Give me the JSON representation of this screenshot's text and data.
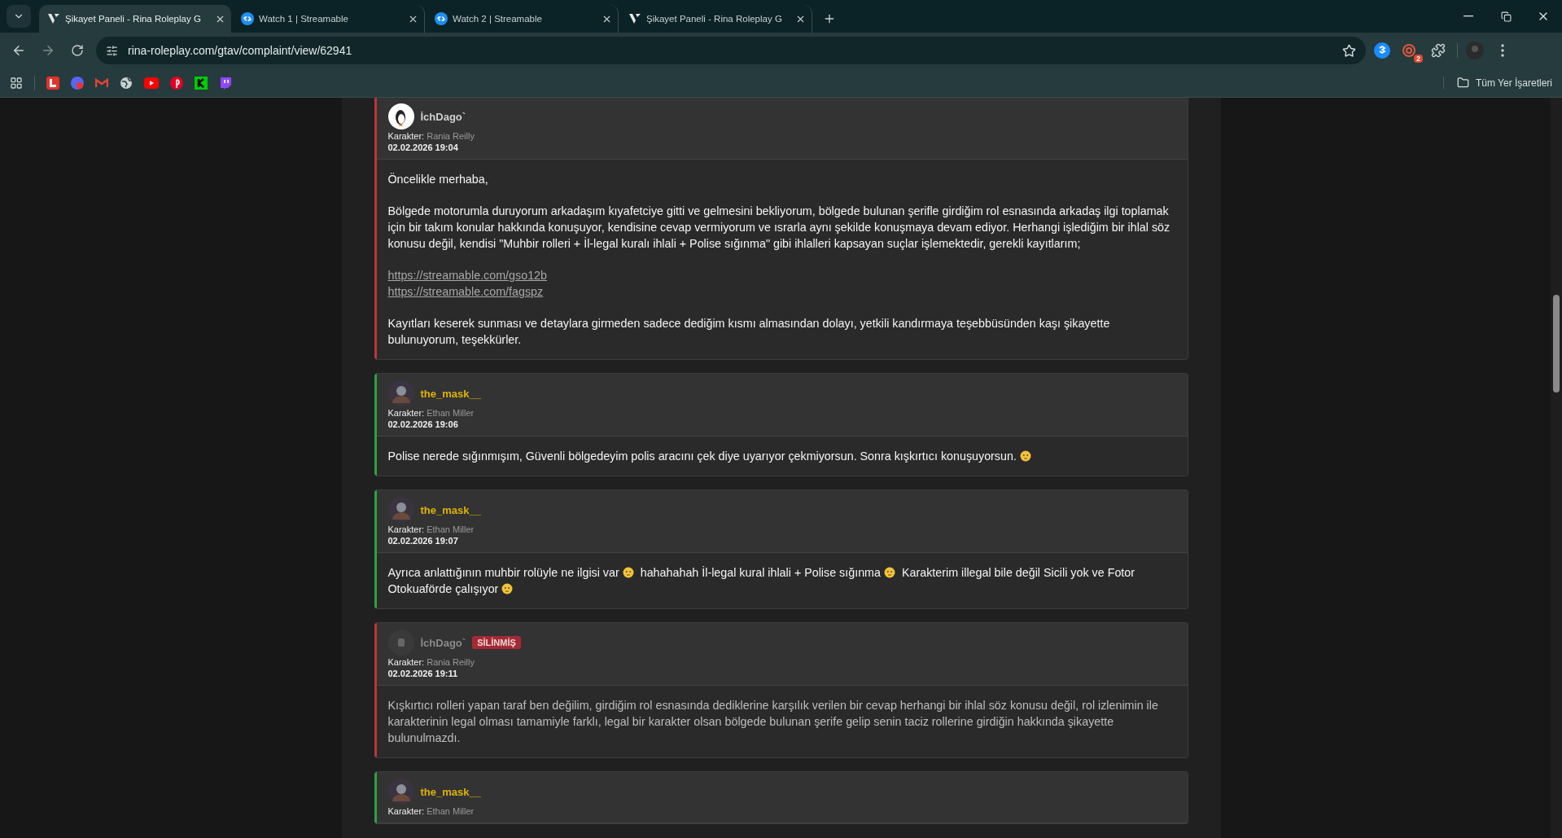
{
  "browser": {
    "tabs": [
      {
        "title": "Şikayet Paneli - Rina Roleplay G",
        "selected": true,
        "kind": "panel"
      },
      {
        "title": "Watch 1 | Streamable",
        "selected": false,
        "kind": "streamable"
      },
      {
        "title": "Watch 2 | Streamable",
        "selected": false,
        "kind": "streamable"
      },
      {
        "title": "Şikayet Paneli - Rina Roleplay G",
        "selected": false,
        "kind": "panel"
      }
    ],
    "address": "rina-roleplay.com/gtav/complaint/view/62941",
    "extension_badge": "2",
    "bookmarks_label": "Tüm Yer İşaretleri"
  },
  "posts": [
    {
      "author": "İchDago`",
      "kind": "complainant",
      "color": "#c0323c",
      "deleted": false,
      "character_label": "Karakter:",
      "character": "Rania Reilly",
      "date": "02.02.2026 19:04",
      "paragraphs": [
        [
          {
            "kind": "text",
            "text": "Öncelikle merhaba,"
          }
        ],
        [
          {
            "kind": "text",
            "text": "Bölgede motorumla duruyorum arkadaşım kıyafetciye gitti ve gelmesini bekliyorum, bölgede bulunan şerifle girdiğim rol esnasında arkadaş ilgi toplamak için bir takım konular hakkında konuşuyor, kendisine cevap vermiyorum ve ısrarla aynı şekilde konuşmaya devam ediyor. Herhangi işlediğim bir ihlal söz konusu değil, kendisi \"Muhbir rolleri + İl-legal kuralı ihlali + Polise sığınma\" gibi ihlalleri kapsayan suçlar işlemektedir, gerekli kayıtlarım;"
          }
        ],
        [
          {
            "kind": "link",
            "text": "https://streamable.com/gso12b"
          },
          {
            "kind": "link",
            "text": "https://streamable.com/fagspz"
          }
        ],
        [
          {
            "kind": "text",
            "text": "Kayıtları keserek sunması ve detaylara girmeden sadece dediğim kısmı almasından dolayı, yetkili kandırmaya teşebbüsünden kaşı şikayette bulunuyorum, teşekkürler."
          }
        ]
      ]
    },
    {
      "author": "the_mask__",
      "kind": "respondent",
      "color": "#2ea043",
      "deleted": false,
      "character_label": "Karakter:",
      "character": "Ethan Miller",
      "date": "02.02.2026 19:06",
      "paragraphs": [
        [
          {
            "kind": "text",
            "text": "Polise nerede sığınmışım, Güvenli bölgedeyim polis aracını çek diye uyarıyor çekmiyorsun. Sonra kışkırtıcı konuşuyorsun."
          },
          {
            "kind": "emoji"
          }
        ]
      ]
    },
    {
      "author": "the_mask__",
      "kind": "respondent",
      "color": "#2ea043",
      "deleted": false,
      "character_label": "Karakter:",
      "character": "Ethan Miller",
      "date": "02.02.2026 19:07",
      "paragraphs": [
        [
          {
            "kind": "text",
            "text": "Ayrıca anlattığının muhbir rolüyle ne ilgisi var"
          },
          {
            "kind": "emoji"
          },
          {
            "kind": "text",
            "text": "hahahahah İl-legal kural ihlali + Polise sığınma"
          },
          {
            "kind": "emoji"
          },
          {
            "kind": "text",
            "text": "Karakterim illegal bile değil Sicili yok ve Fotor Otokuaförde çalışıyor"
          },
          {
            "kind": "emoji"
          }
        ]
      ]
    },
    {
      "author": "İchDago`",
      "kind": "complainant",
      "color": "#c0323c",
      "deleted": true,
      "badge": "SİLİNMİŞ",
      "character_label": "Karakter:",
      "character": "Rania Reilly",
      "date": "02.02.2026 19:11",
      "paragraphs": [
        [
          {
            "kind": "text",
            "text": "Kışkırtıcı rolleri yapan taraf ben değilim, girdiğim rol esnasında dediklerine karşılık verilen bir cevap herhangi bir ihlal söz konusu değil, rol izlenimin ile karakterinin legal olması tamamiyle farklı, legal bir karakter olsan bölgede bulunan şerife gelip senin taciz rollerine girdiğin hakkında şikayette bulunulmazdı."
          }
        ]
      ]
    },
    {
      "author": "the_mask__",
      "kind": "respondent",
      "color": "#2ea043",
      "deleted": false,
      "character_label": "Karakter:",
      "character": "Ethan Miller"
    }
  ]
}
